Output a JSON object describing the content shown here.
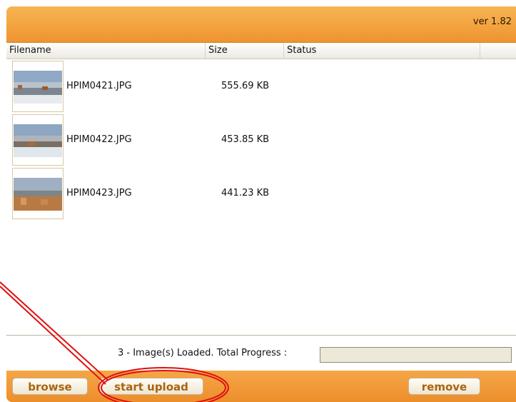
{
  "header": {
    "version": "ver 1.82"
  },
  "columns": [
    {
      "label": "Filename"
    },
    {
      "label": "Size"
    },
    {
      "label": "Status"
    }
  ],
  "files": [
    {
      "name": "HPIM0421.JPG",
      "size": "555.69 KB",
      "status": ""
    },
    {
      "name": "HPIM0422.JPG",
      "size": "453.85 KB",
      "status": ""
    },
    {
      "name": "HPIM0423.JPG",
      "size": "441.23 KB",
      "status": ""
    }
  ],
  "footer": {
    "summary": "3 - Image(s) Loaded.   Total Progress :",
    "progress": 0
  },
  "buttons": {
    "browse": "browse",
    "start_upload": "start upload",
    "remove": "remove"
  },
  "colors": {
    "accent": "#f5a23f",
    "button_text": "#a96412",
    "annotation": "#e01010"
  }
}
